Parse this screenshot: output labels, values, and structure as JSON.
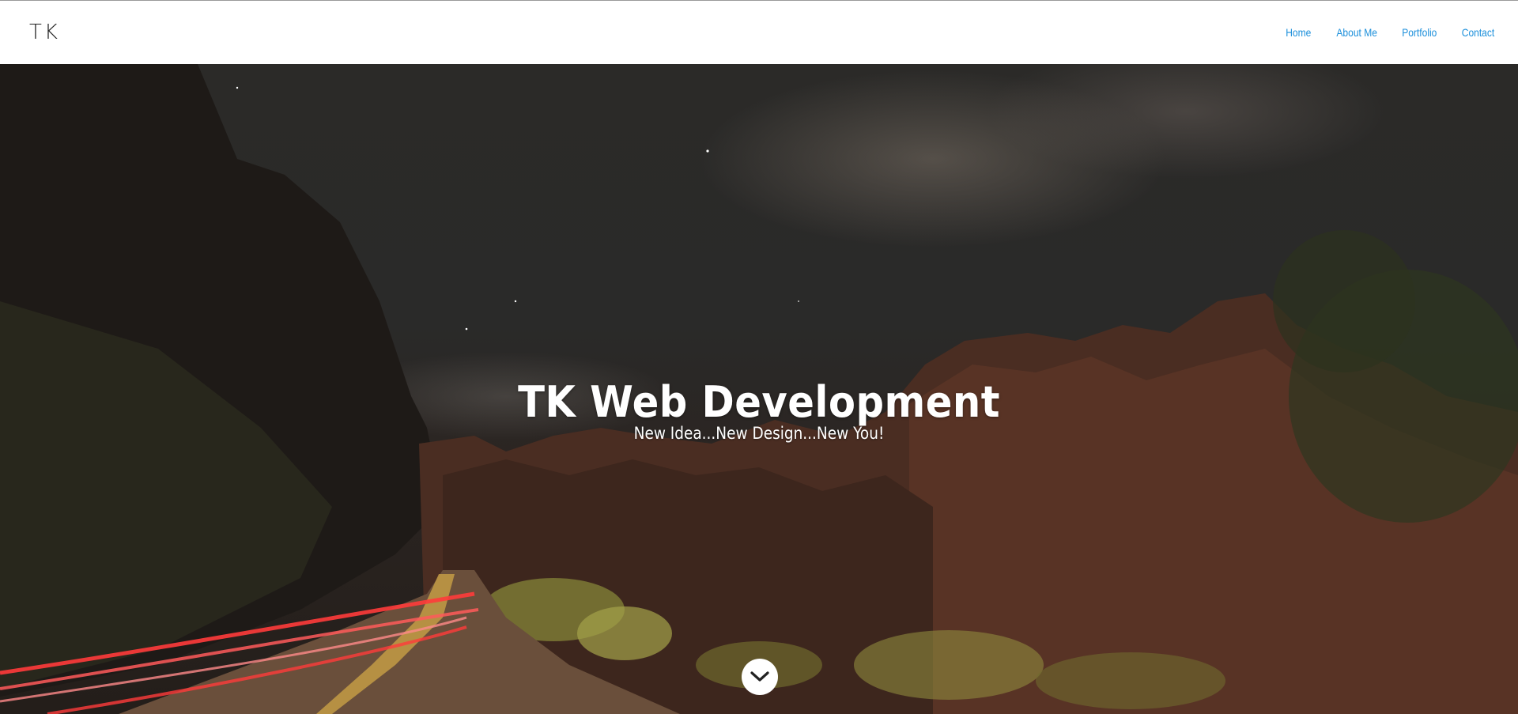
{
  "brand": {
    "logo_text": "TK"
  },
  "nav": {
    "items": [
      {
        "label": "Home"
      },
      {
        "label": "About Me"
      },
      {
        "label": "Portfolio"
      },
      {
        "label": "Contact"
      }
    ],
    "link_color": "#1b8fdb"
  },
  "hero": {
    "title": "TK Web Development",
    "subtitle": "New Idea...New Design...New You!",
    "scroll_icon": "chevron-down-icon"
  }
}
